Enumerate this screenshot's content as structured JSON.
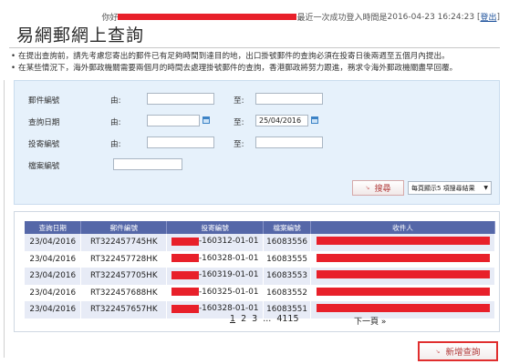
{
  "header": {
    "greeting": "你好",
    "last_login_label": "最近一次成功登入時間是",
    "last_login_time": "2016-04-23 16:24:23",
    "logout_label": "登出",
    "redaction_color": "#e8202a"
  },
  "page": {
    "title": "易網郵網上查詢"
  },
  "notes": [
    "在提出查詢前，請先考慮您寄出的郵件已有足夠時間到達目的地，出口掛號郵件的查詢必須在投寄日後兩週至五個月內提出。",
    "在某些情況下，海外郵政機關需要兩個月的時間去處理掛號郵件的查詢，香港郵政將努力跟進，務求令海外郵政機關盡早回覆。"
  ],
  "search": {
    "from_label": "由:",
    "to_label": "至:",
    "fields": {
      "item_no_label": "郵件編號",
      "query_date_label": "查詢日期",
      "posting_no_label": "投寄編號",
      "file_no_label": "檔案編號"
    },
    "item_no_from": "",
    "item_no_to": "",
    "date_from": "",
    "date_to": "25/04/2016",
    "posting_from": "",
    "posting_to": "",
    "file_no": "",
    "search_button": "搜尋",
    "per_page_select": "每頁顯示5 項搜尋結果"
  },
  "results": {
    "columns": [
      "查詢日期",
      "郵件編號",
      "投寄編號",
      "檔案編號",
      "收件人"
    ],
    "rows": [
      {
        "date": "23/04/2016",
        "item": "RT322457745HK",
        "posting_suffix": "-160312-01-01",
        "file": "16083556"
      },
      {
        "date": "23/04/2016",
        "item": "RT322457728HK",
        "posting_suffix": "-160328-01-01",
        "file": "16083555"
      },
      {
        "date": "23/04/2016",
        "item": "RT322457705HK",
        "posting_suffix": "-160319-01-01",
        "file": "16083553"
      },
      {
        "date": "23/04/2016",
        "item": "RT322457688HK",
        "posting_suffix": "-160325-01-01",
        "file": "16083552"
      },
      {
        "date": "23/04/2016",
        "item": "RT322457657HK",
        "posting_suffix": "-160328-01-01",
        "file": "16083551"
      }
    ]
  },
  "pagination": {
    "pages": [
      "1",
      "2",
      "3",
      "...",
      "4115"
    ],
    "current": "1",
    "next_label": "下一頁 »"
  },
  "actions": {
    "new_query": "新增查詢"
  }
}
